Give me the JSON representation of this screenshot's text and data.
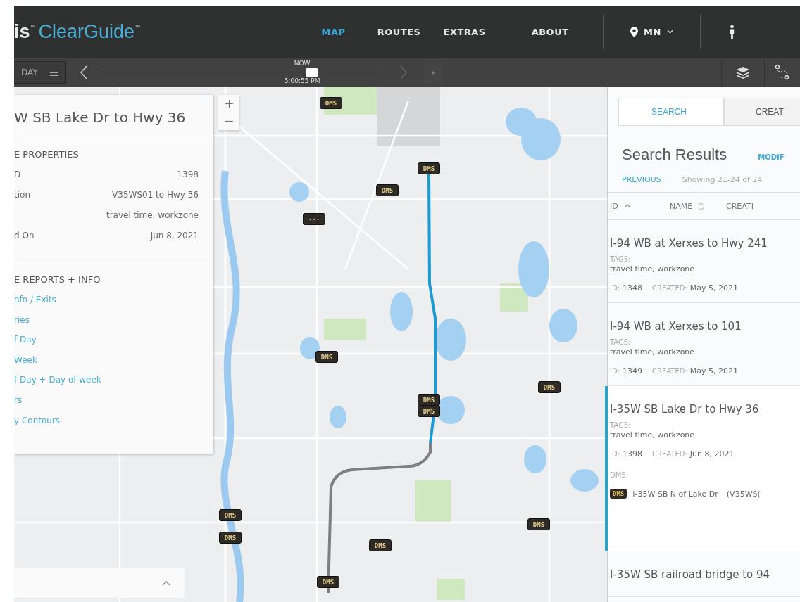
{
  "brand": {
    "prefix": "is",
    "name": "ClearGuide",
    "mark": "™"
  },
  "nav": [
    {
      "label": "MAP",
      "selected": true
    },
    {
      "label": "ROUTES",
      "selected": false
    },
    {
      "label": "EXTRAS",
      "selected": false
    },
    {
      "label": "ABOUT",
      "selected": false
    }
  ],
  "region": {
    "label": "MN"
  },
  "timeline": {
    "mode": "DAY",
    "now_label": "NOW",
    "time": "5:00:55 PM",
    "level": 0.71,
    "forward_disabled": true
  },
  "route_panel": {
    "title": "W SB Lake Dr to Hwy 36",
    "properties_heading": "E PROPERTIES",
    "properties": [
      {
        "label": "D",
        "value": "1398"
      },
      {
        "label": "tion",
        "value": "V35WS01 to Hwy 36"
      },
      {
        "value": "travel time, workzone"
      },
      {
        "label": "d On",
        "value": "Jun 8, 2021"
      }
    ],
    "reports_heading": "E REPORTS + INFO",
    "reports": [
      "nfo / Exits",
      "ries",
      "f Day",
      "Week",
      "f Day + Day of week",
      "rs",
      "y Contours"
    ]
  },
  "search_panel": {
    "tabs": [
      {
        "label": "SEARCH",
        "selected": true
      },
      {
        "label": "CREAT",
        "selected": false
      }
    ],
    "heading": "Search Results",
    "modify": "MODIF",
    "previous": "PREVIOUS",
    "showing": "Showing 21-24 of 24",
    "columns": [
      {
        "label": "ID",
        "sorted": true
      },
      {
        "label": "NAME",
        "sorted": false
      },
      {
        "label": "CREATI"
      }
    ],
    "results": [
      {
        "title": "I-94 WB at Xerxes to Hwy 241",
        "tags_label": "TAGS:",
        "tags": "travel time, workzone",
        "id_label": "ID:",
        "id": "1348",
        "created_label": "CREATED:",
        "created": "May 5, 2021",
        "selected": false
      },
      {
        "title": "I-94 WB at Xerxes to 101",
        "tags_label": "TAGS:",
        "tags": "travel time, workzone",
        "id_label": "ID:",
        "id": "1349",
        "created_label": "CREATED:",
        "created": "May 5, 2021",
        "selected": false
      },
      {
        "title": "I-35W SB Lake Dr to Hwy 36",
        "tags_label": "TAGS:",
        "tags": "travel time, workzone",
        "id_label": "ID:",
        "id": "1398",
        "created_label": "CREATED:",
        "created": "Jun 8, 2021",
        "selected": true,
        "dms_label": "DMS:",
        "dms": [
          {
            "badge": "DMS",
            "name": "I-35W SB N of Lake Dr",
            "code": "(V35WS("
          }
        ]
      },
      {
        "title": "I-35W SB railroad bridge to 94",
        "selected": false
      }
    ]
  },
  "map": {
    "markers": [
      {
        "label": "DMS"
      },
      {
        "label": "DMS"
      },
      {
        "label": "DMS"
      },
      {
        "label": "···"
      },
      {
        "label": "DMS"
      },
      {
        "label": "DMS"
      },
      {
        "label": "DMS"
      },
      {
        "label": "DMS"
      },
      {
        "label": "DMS"
      },
      {
        "label": "DMS"
      },
      {
        "label": "DMS"
      },
      {
        "label": "DMS"
      },
      {
        "label": "DMS"
      }
    ]
  }
}
